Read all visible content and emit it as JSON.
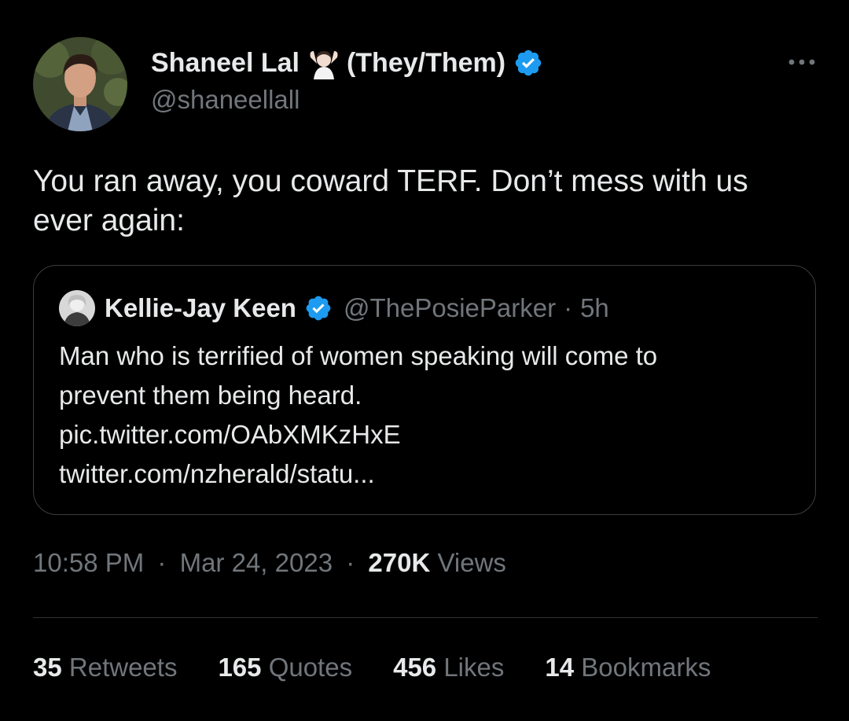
{
  "tweet": {
    "author": {
      "display_name": "Shaneel Lal",
      "pronouns": "(They/Them)",
      "handle": "@shaneellall",
      "emoji": "person-with-raised-hands-emoji",
      "verified": true
    },
    "text_lines": [
      "You ran away, you coward TERF. Don’t mess with us",
      "ever again:"
    ],
    "quoted": {
      "display_name": "Kellie-Jay Keen",
      "handle": "@ThePosieParker",
      "separator": "·",
      "age": "5h",
      "verified": true,
      "text_lines": [
        "Man who is terrified of women speaking will come to",
        "prevent them being heard.",
        "pic.twitter.com/OAbXMKzHxE",
        "twitter.com/nzherald/statu..."
      ]
    },
    "time": "10:58 PM",
    "date": "Mar 24, 2023",
    "separator": "·",
    "views_count": "270K",
    "views_label": "Views",
    "stats": {
      "retweets": {
        "count": "35",
        "label": "Retweets"
      },
      "quotes": {
        "count": "165",
        "label": "Quotes"
      },
      "likes": {
        "count": "456",
        "label": "Likes"
      },
      "bookmarks": {
        "count": "14",
        "label": "Bookmarks"
      }
    }
  },
  "colors": {
    "background": "#000000",
    "text": "#e7e9ea",
    "secondary": "#71767b",
    "verified": "#1d9bf0",
    "border": "#2f3336"
  },
  "icons": {
    "more": "more-horizontal-icon",
    "verified": "verified-badge-icon"
  }
}
